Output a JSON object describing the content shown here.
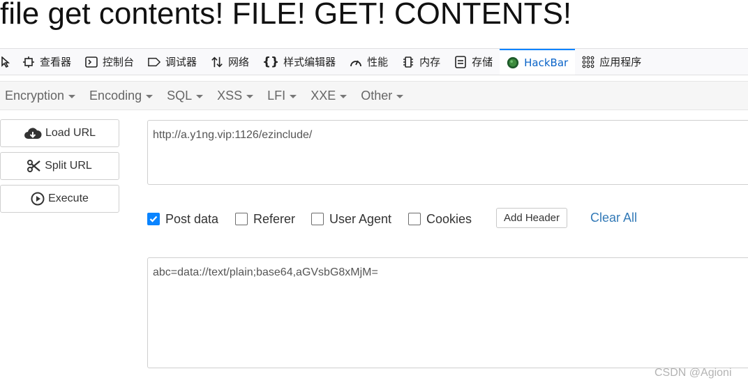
{
  "page": {
    "heading": "file get contents! FILE! GET! CONTENTS!"
  },
  "devtools": {
    "tabs": [
      {
        "label": "查看器",
        "icon": "inspector-icon",
        "active": false
      },
      {
        "label": "控制台",
        "icon": "console-icon",
        "active": false
      },
      {
        "label": "调试器",
        "icon": "debugger-icon",
        "active": false
      },
      {
        "label": "网络",
        "icon": "network-icon",
        "active": false
      },
      {
        "label": "样式编辑器",
        "icon": "style-editor-icon",
        "active": false
      },
      {
        "label": "性能",
        "icon": "performance-icon",
        "active": false
      },
      {
        "label": "内存",
        "icon": "memory-icon",
        "active": false
      },
      {
        "label": "存储",
        "icon": "storage-icon",
        "active": false
      },
      {
        "label": "HackBar",
        "icon": "hackbar-icon",
        "active": true
      },
      {
        "label": "应用程序",
        "icon": "application-icon",
        "active": false
      }
    ]
  },
  "hackbar": {
    "menu": [
      "Encryption",
      "Encoding",
      "SQL",
      "XSS",
      "LFI",
      "XXE",
      "Other"
    ],
    "buttons": {
      "load_url": "Load URL",
      "split_url": "Split URL",
      "execute": "Execute"
    },
    "url": "http://a.y1ng.vip:1126/ezinclude/",
    "options": {
      "post_data": {
        "label": "Post data",
        "checked": true
      },
      "referer": {
        "label": "Referer",
        "checked": false
      },
      "user_agent": {
        "label": "User Agent",
        "checked": false
      },
      "cookies": {
        "label": "Cookies",
        "checked": false
      }
    },
    "add_header": "Add Header",
    "clear_all": "Clear All",
    "post_body": "abc=data://text/plain;base64,aGVsbG8xMjM="
  },
  "watermark": "CSDN @Agioni",
  "colors": {
    "accent": "#0a84ff",
    "link": "#337ab7",
    "active_tab_text": "#0a64c8"
  }
}
